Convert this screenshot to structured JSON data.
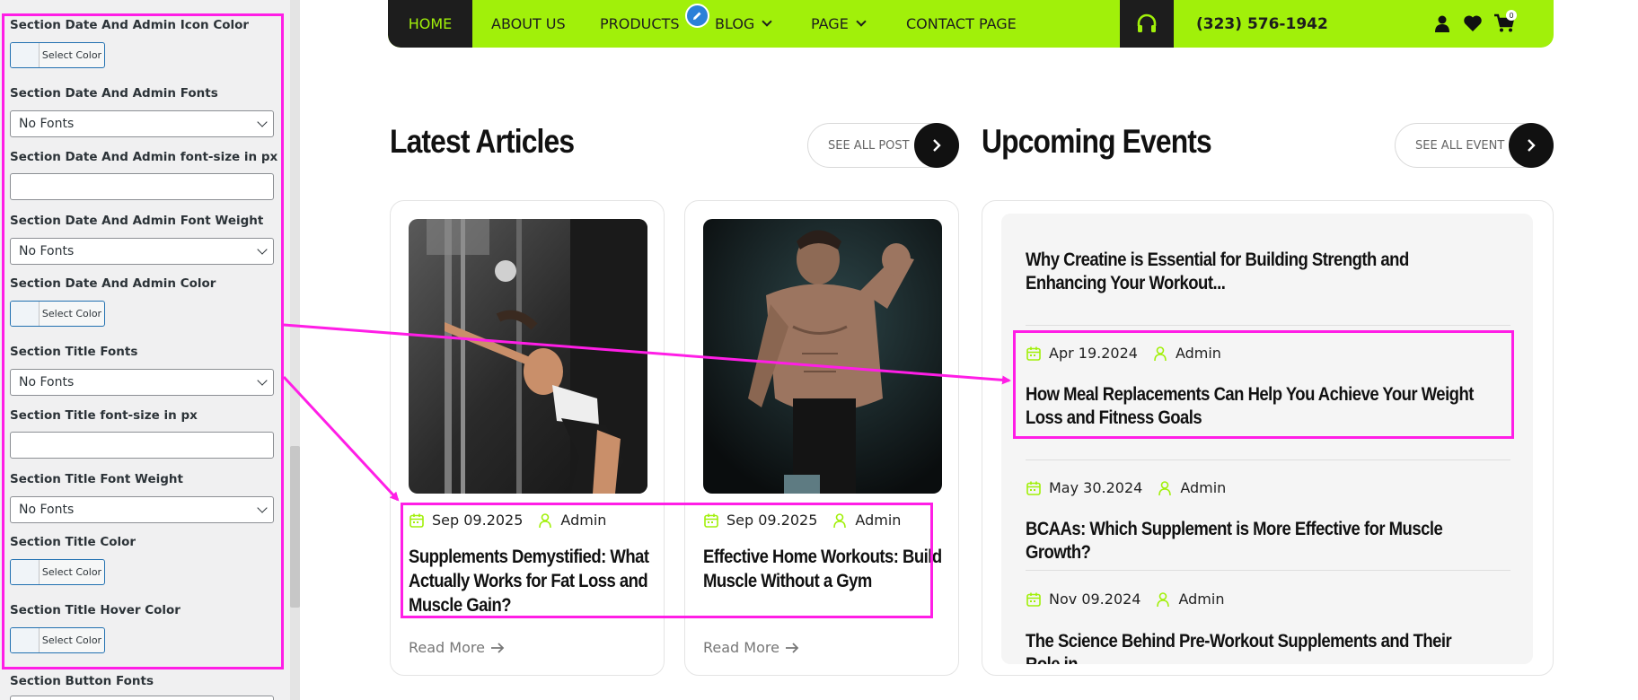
{
  "sidebar": {
    "fields": [
      {
        "label": "Section Date And Admin Icon Color",
        "type": "color",
        "button_label": "Select Color"
      },
      {
        "label": "Section Date And Admin Fonts",
        "type": "select",
        "value": "No Fonts"
      },
      {
        "label": "Section Date And Admin font-size in px",
        "type": "text",
        "value": ""
      },
      {
        "label": "Section Date And Admin Font Weight",
        "type": "select",
        "value": "No Fonts"
      },
      {
        "label": "Section Date And Admin Color",
        "type": "color",
        "button_label": "Select Color"
      },
      {
        "label": "Section Title Fonts",
        "type": "select",
        "value": "No Fonts"
      },
      {
        "label": "Section Title font-size in px",
        "type": "text",
        "value": ""
      },
      {
        "label": "Section Title Font Weight",
        "type": "select",
        "value": "No Fonts"
      },
      {
        "label": "Section Title Color",
        "type": "color",
        "button_label": "Select Color"
      },
      {
        "label": "Section Title Hover Color",
        "type": "color",
        "button_label": "Select Color"
      },
      {
        "label": "Section Button Fonts",
        "type": "select",
        "value": ""
      }
    ]
  },
  "nav": {
    "items": [
      "HOME",
      "ABOUT US",
      "PRODUCTS",
      "BLOG",
      "PAGE",
      "CONTACT PAGE"
    ],
    "phone": "(323) 576-1942",
    "cart_count": "0",
    "accent_color": "#a1f00a",
    "dark_color": "#1d1d1d"
  },
  "articles": {
    "heading": "Latest Articles",
    "see_all": "SEE ALL POST",
    "posts": [
      {
        "date": "Sep 09.2025",
        "author": "Admin",
        "title": "Supplements Demystified: What Actually Works for Fat Loss and Muscle Gain?",
        "read_more": "Read More"
      },
      {
        "date": "Sep 09.2025",
        "author": "Admin",
        "title": "Effective Home Workouts: Build Muscle Without a Gym",
        "read_more": "Read More"
      }
    ]
  },
  "events": {
    "heading": "Upcoming Events",
    "see_all": "SEE ALL EVENT",
    "items": [
      {
        "title": "Why Creatine is Essential for Building Strength and Enhancing Your Workout..."
      },
      {
        "date": "Apr 19.2024",
        "author": "Admin",
        "title": "How Meal Replacements Can Help You Achieve Your Weight Loss and Fitness Goals"
      },
      {
        "date": "May 30.2024",
        "author": "Admin",
        "title": "BCAAs: Which Supplement is More Effective for Muscle Growth?"
      },
      {
        "date": "Nov 09.2024",
        "author": "Admin",
        "title": "The Science Behind Pre-Workout Supplements and Their Role in"
      }
    ]
  },
  "annotation_color": "#ff1ee6"
}
